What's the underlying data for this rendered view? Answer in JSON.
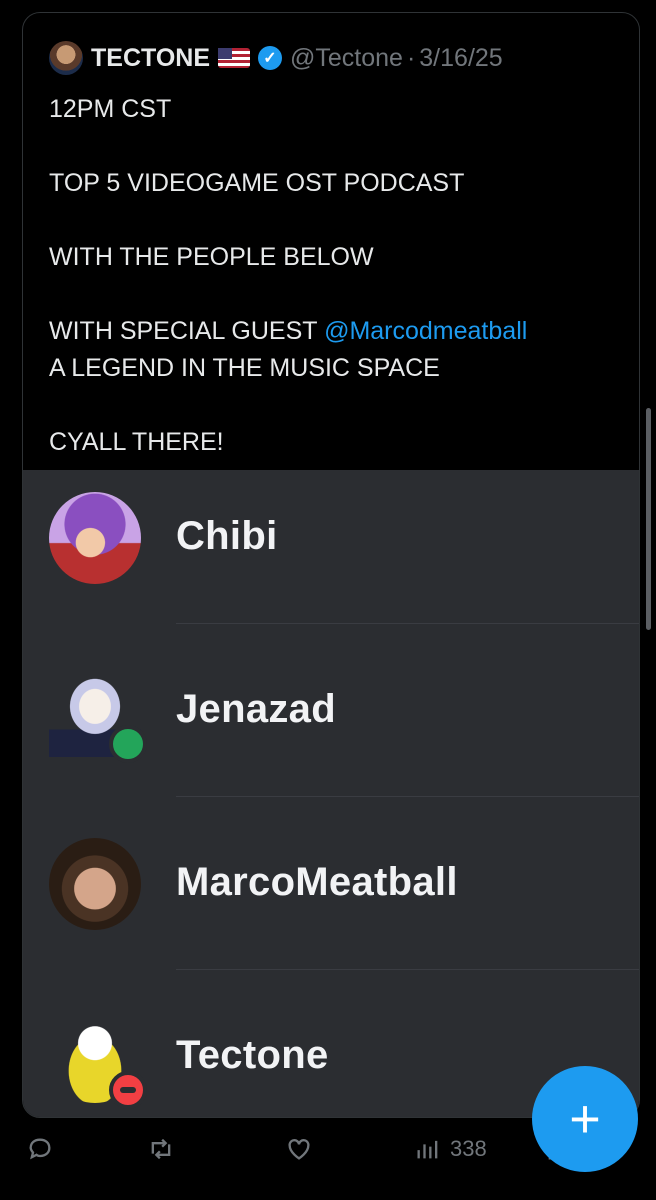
{
  "tweet": {
    "author": "TECTONE",
    "handle": "@Tectone",
    "date_sep": "·",
    "date": "3/16/25",
    "lines": [
      "12PM CST",
      "",
      "TOP 5 VIDEOGAME OST PODCAST",
      "",
      "WITH THE PEOPLE BELOW",
      "",
      "WITH SPECIAL GUEST ",
      "A LEGEND IN THE MUSIC SPACE",
      "",
      "CYALL THERE!"
    ],
    "mention": "@Marcodmeatball",
    "verified_icon": "verified-badge-icon",
    "flag_icon": "us-flag-icon"
  },
  "members": [
    {
      "name": "Chibi",
      "status": ""
    },
    {
      "name": "Jenazad",
      "status": "online"
    },
    {
      "name": "MarcoMeatball",
      "status": ""
    },
    {
      "name": "Tectone",
      "status": "dnd"
    }
  ],
  "actions": {
    "views": "338",
    "icons": [
      "reply-icon",
      "retweet-icon",
      "like-icon",
      "views-icon",
      "share-icon"
    ]
  },
  "fab": {
    "label": "+"
  },
  "colors": {
    "accent": "#1d9bf0",
    "embed_bg": "#2b2d31",
    "online": "#23a55a",
    "dnd": "#f23f43"
  }
}
